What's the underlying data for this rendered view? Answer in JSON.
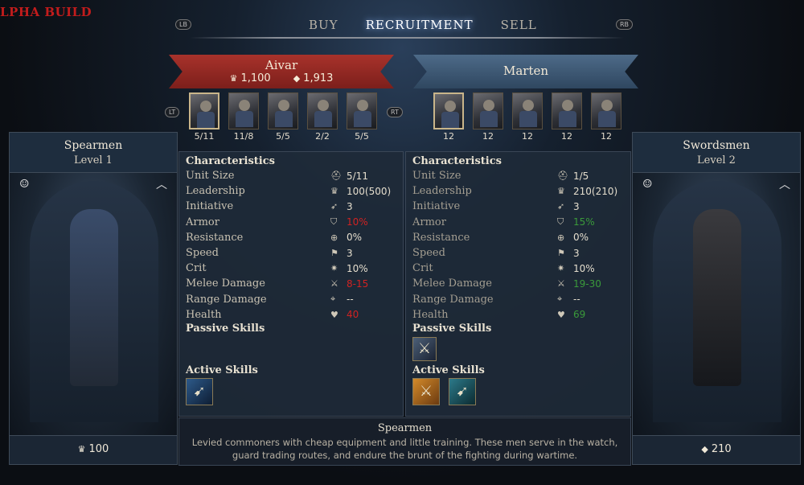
{
  "alpha_label": "LPHA BUILD",
  "tabs": [
    "BUY",
    "RECRUITMENT",
    "SELL"
  ],
  "buttons": {
    "lb": "LB",
    "rb": "RB",
    "lt": "LT",
    "rt": "RT"
  },
  "left_player": {
    "name": "Aivar",
    "leadership": "1,100",
    "gold": "1,913",
    "units": [
      "5/11",
      "11/8",
      "5/5",
      "2/2",
      "5/5"
    ]
  },
  "right_player": {
    "name": "Marten",
    "units": [
      "12",
      "12",
      "12",
      "12",
      "12"
    ]
  },
  "left_card": {
    "name": "Spearmen",
    "level": "Level 1",
    "cost": "100"
  },
  "right_card": {
    "name": "Swordsmen",
    "level": "Level 2",
    "cost": "210"
  },
  "left_stats": {
    "characteristics": "Characteristics",
    "rows": [
      {
        "label": "Unit Size",
        "value": "5/11"
      },
      {
        "label": "Leadership",
        "value": "100(500)"
      },
      {
        "label": "Initiative",
        "value": "3"
      },
      {
        "label": "Armor",
        "value": "10%"
      },
      {
        "label": "Resistance",
        "value": "0%"
      },
      {
        "label": "Speed",
        "value": "3"
      },
      {
        "label": "Crit",
        "value": "10%"
      },
      {
        "label": "Melee Damage",
        "value": "8-15"
      },
      {
        "label": "Range Damage",
        "value": "--"
      },
      {
        "label": "Health",
        "value": "40"
      }
    ],
    "passive": "Passive Skills",
    "active": "Active Skills"
  },
  "right_stats": {
    "characteristics": "Characteristics",
    "rows": [
      {
        "label": "Unit Size",
        "value": "1/5"
      },
      {
        "label": "Leadership",
        "value": "210(210)"
      },
      {
        "label": "Initiative",
        "value": "3"
      },
      {
        "label": "Armor",
        "value": "15%"
      },
      {
        "label": "Resistance",
        "value": "0%"
      },
      {
        "label": "Speed",
        "value": "3"
      },
      {
        "label": "Crit",
        "value": "10%"
      },
      {
        "label": "Melee Damage",
        "value": "19-30"
      },
      {
        "label": "Range Damage",
        "value": "--"
      },
      {
        "label": "Health",
        "value": "69"
      }
    ],
    "passive": "Passive Skills",
    "active": "Active Skills"
  },
  "description": {
    "title": "Spearmen",
    "body": "Levied commoners with cheap equipment and little training. These men serve in the watch, guard trading routes, and endure the brunt of the fighting during wartime."
  },
  "icons": {
    "unit_size": "helmet-icon",
    "leadership": "crown-icon",
    "initiative": "wing-icon",
    "armor": "shield-icon",
    "resistance": "resist-shield-icon",
    "speed": "boot-icon",
    "crit": "crit-sword-icon",
    "melee": "sword-icon",
    "range": "crosshair-icon",
    "health": "heart-icon"
  },
  "colors": {
    "stat_bad": "#d02222",
    "stat_good": "#3a9a3a",
    "banner_red": "#a8322b",
    "banner_blue": "#4d6a88"
  }
}
